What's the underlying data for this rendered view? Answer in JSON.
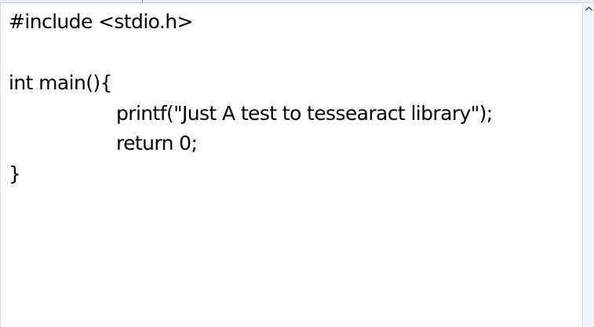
{
  "editor": {
    "lines": [
      "#include <stdio.h>",
      "int main(){",
      "printf(\"Just A test to tessearact library\");",
      "return 0;",
      "}"
    ]
  },
  "icons": {
    "scroll_up": "chevron-up-icon"
  },
  "colors": {
    "background": "#ffffff",
    "text": "#000000",
    "scrollbar_track": "#f0f3f7",
    "frame": "#c9d1da"
  }
}
